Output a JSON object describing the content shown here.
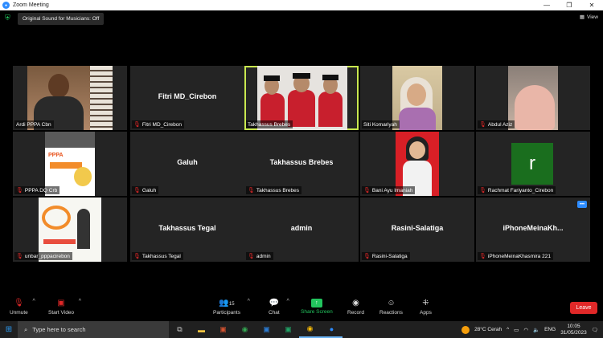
{
  "window": {
    "title": "Zoom Meeting"
  },
  "topbar": {
    "sound_status": "Original Sound for Musicians: Off",
    "view_label": "View"
  },
  "participants": [
    {
      "name": "Ardi PPPA Cbn",
      "center_text": "",
      "muted": false,
      "video": true
    },
    {
      "name": "Fitri MD_Cirebon",
      "center_text": "Fitri MD_Cirebon",
      "muted": true,
      "video": false
    },
    {
      "name": "Takhassus Brebes",
      "center_text": "",
      "muted": false,
      "video": true,
      "active": true
    },
    {
      "name": "Siti Komariyah",
      "center_text": "",
      "muted": false,
      "video": true
    },
    {
      "name": "Abdul Aziz",
      "center_text": "",
      "muted": true,
      "video": true
    },
    {
      "name": "PPPA DQ Crb",
      "center_text": "",
      "muted": true,
      "video": true
    },
    {
      "name": "Galuh",
      "center_text": "Galuh",
      "muted": true,
      "video": false
    },
    {
      "name": "Takhassus Brebes",
      "center_text": "Takhassus Brebes",
      "muted": true,
      "video": false
    },
    {
      "name": "Bani Ayu Imaniah",
      "center_text": "",
      "muted": true,
      "video": true
    },
    {
      "name": "Rachmat Fariyanto_Cirebon",
      "center_text": "",
      "muted": true,
      "video": false,
      "avatar_letter": "r"
    },
    {
      "name": "unbar_pppacirebon",
      "center_text": "",
      "muted": true,
      "video": true
    },
    {
      "name": "Takhassus Tegal",
      "center_text": "Takhassus Tegal",
      "muted": true,
      "video": false
    },
    {
      "name": "admin",
      "center_text": "admin",
      "muted": true,
      "video": false
    },
    {
      "name": "Rasini-Salatiga",
      "center_text": "Rasini-Salatiga",
      "muted": true,
      "video": false
    },
    {
      "name": "iPhoneMeinaKhasmira 221",
      "center_text": "iPhoneMeinaKh...",
      "muted": true,
      "video": false
    }
  ],
  "toolbar": {
    "unmute": "Unmute",
    "start_video": "Start Video",
    "participants": "Participants",
    "participant_count": "15",
    "chat": "Chat",
    "share_screen": "Share Screen",
    "record": "Record",
    "reactions": "Reactions",
    "apps": "Apps",
    "leave": "Leave"
  },
  "taskbar": {
    "search_placeholder": "Type here to search",
    "weather": "28°C Cerah",
    "lang": "ENG",
    "time": "10:05",
    "date": "31/05/2023"
  },
  "colors": {
    "leave": "#e02828",
    "share": "#22c55e",
    "active_border": "#c9e84f",
    "zoom_blue": "#2d8cff"
  }
}
